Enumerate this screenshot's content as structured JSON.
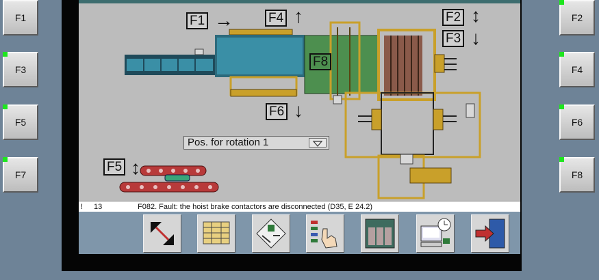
{
  "side_buttons": {
    "left": [
      "F1",
      "F3",
      "F5",
      "F7"
    ],
    "right": [
      "F2",
      "F4",
      "F6",
      "F8"
    ]
  },
  "diagram": {
    "labels": {
      "f1": "F1",
      "f2": "F2",
      "f3": "F3",
      "f4": "F4",
      "f5": "F5",
      "f6": "F6",
      "f8": "F8"
    },
    "arrows": {
      "f1": "→",
      "f2": "↕",
      "f3": "↓",
      "f4": "↑",
      "f5": "↕",
      "f6": "↓"
    }
  },
  "dropdown": {
    "value": "Pos. for rotation 1"
  },
  "message": {
    "marker": "!",
    "number": "13",
    "text": "F082. Fault: the hoist brake contactors are disconnected (D35, E 24.2)"
  },
  "toolbar": {
    "icons": [
      "resize-arrows-icon",
      "pallet-stack-icon",
      "palette-pattern-icon",
      "hand-select-icon",
      "cabinet-icon",
      "terminal-clock-icon",
      "exit-door-icon"
    ]
  },
  "colors": {
    "screen_bg": "#bcbcbc",
    "conveyor_blue": "#3a8fa6",
    "roller_green": "#4d8f4f",
    "frame_gold": "#c9a02a",
    "brown_stack": "#8a5a4a",
    "red_belt": "#b83a3a",
    "led_green": "#1ee61e",
    "toolbar_bg": "#7f96aa",
    "side_bg": "#6e8397"
  }
}
